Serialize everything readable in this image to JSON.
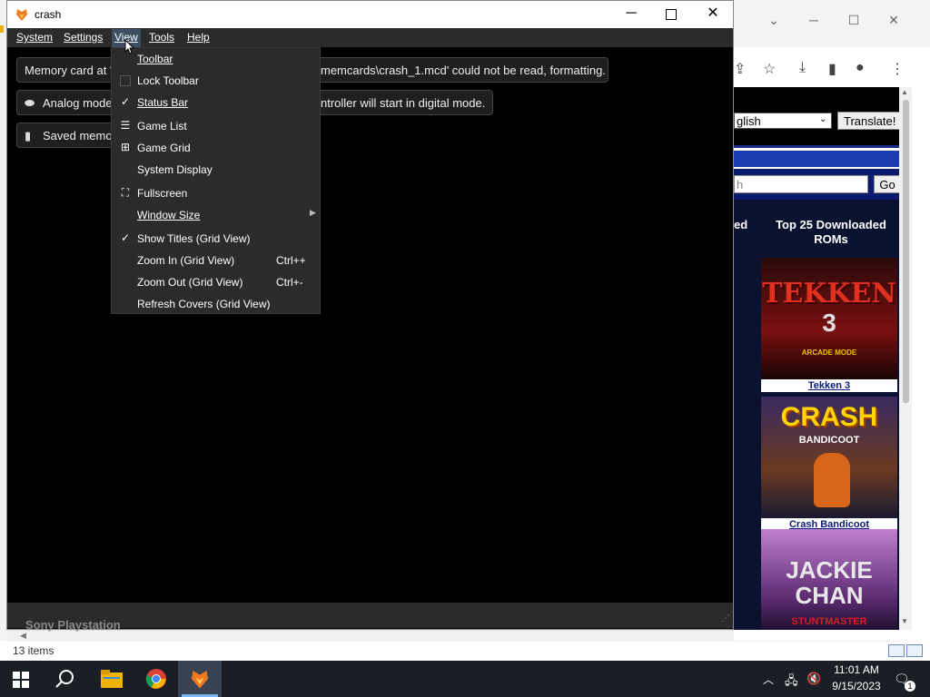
{
  "explorer": {
    "status_items": "13 items"
  },
  "chrome": {
    "language_value": "glish",
    "translate_label": "Translate!",
    "search_placeholder": "h",
    "go_label": "Go",
    "side_heading_fragment": "ed",
    "top_heading": "Top 25 Downloaded ROMs",
    "roms": [
      {
        "title": "Tekken 3",
        "art_text": "TEKKEN",
        "art_number": "3",
        "art_sub": "ARCADE MODE"
      },
      {
        "title": "Crash Bandicoot",
        "art_text": "CRASH",
        "art_sub": "BANDICOOT"
      },
      {
        "title": "",
        "art_text": "JACKIE",
        "art_sub": "CHAN",
        "art_sub2": "STUNTMASTER"
      }
    ]
  },
  "duckstation": {
    "title": "crash",
    "menubar": [
      "System",
      "Settings",
      "View",
      "Tools",
      "Help"
    ],
    "osd": [
      {
        "left_text": "Memory card at '",
        "right_text": "memcards\\crash_1.mcd' could not be read, formatting.",
        "icon": ""
      },
      {
        "left_text": "Analog mode",
        "right_text": "ntroller will start in digital mode.",
        "icon": "gamepad-icon"
      },
      {
        "left_text": "Saved memo",
        "right_text": "",
        "icon": "memory-card-icon"
      }
    ],
    "bottom_text": "Sony Playstation",
    "view_menu": [
      {
        "label": "Toolbar",
        "shortcut": "",
        "icon": "",
        "checked": false
      },
      {
        "label": "Lock Toolbar",
        "shortcut": "",
        "icon": "checkbox",
        "checked": false
      },
      {
        "label": "Status Bar",
        "shortcut": "",
        "icon": "check",
        "checked": true
      },
      {
        "label": "Game List",
        "shortcut": "",
        "icon": "list",
        "checked": false
      },
      {
        "label": "Game Grid",
        "shortcut": "",
        "icon": "grid",
        "checked": false
      },
      {
        "label": "System Display",
        "shortcut": "",
        "icon": "",
        "checked": false
      },
      {
        "label": "Fullscreen",
        "shortcut": "",
        "icon": "fullscreen",
        "checked": false
      },
      {
        "label": "Window Size",
        "shortcut": "",
        "icon": "",
        "checked": false,
        "submenu": true
      },
      {
        "label": "Show Titles (Grid View)",
        "shortcut": "",
        "icon": "check",
        "checked": true
      },
      {
        "label": "Zoom In (Grid View)",
        "shortcut": "Ctrl++",
        "icon": "",
        "checked": false
      },
      {
        "label": "Zoom Out (Grid View)",
        "shortcut": "Ctrl+-",
        "icon": "",
        "checked": false
      },
      {
        "label": "Refresh Covers (Grid View)",
        "shortcut": "",
        "icon": "",
        "checked": false
      }
    ]
  },
  "taskbar": {
    "time": "11:01 AM",
    "date": "9/15/2023",
    "notification_count": "1"
  },
  "colors": {
    "menu_bg": "#2b2b2b",
    "menu_highlight": "#3d4d63",
    "taskbar_bg": "#1a1f26",
    "site_blue": "#1a3bb0"
  }
}
